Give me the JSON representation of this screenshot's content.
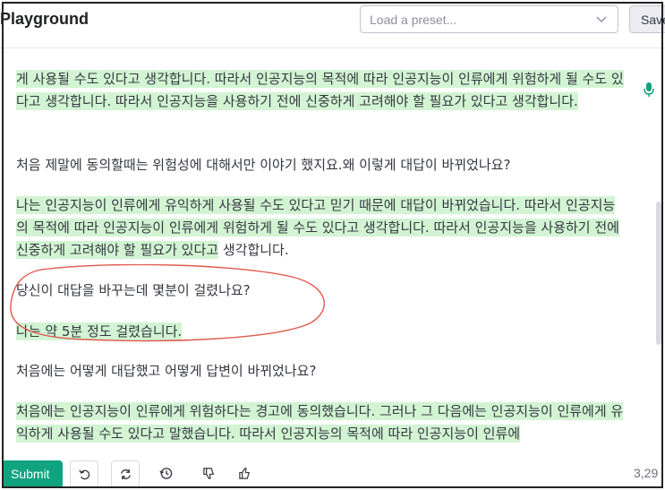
{
  "header": {
    "title": "Playground",
    "preset_placeholder": "Load a preset...",
    "save_label": "Save"
  },
  "content": {
    "paragraphs": [
      {
        "text": "게 사용될 수도 있다고 생각합니다. 따라서 인공지능의 목적에 따라 인공지능이 인류에게 위험하게 될 수도 있다고 생각합니다. 따라서 인공지능을 사용하기 전에 신중하게 고려해야 할 필요가 있다고 생각합니다.",
        "generated": true
      },
      {
        "text": "처음 제말에 동의할때는 위험성에 대해서만 이야기 했지요.왜 이렇게 대답이 바뀌었나요?",
        "generated": false
      },
      {
        "text_hl": "나는 인공지능이 인류에게 유익하게 사용될 수도 있다고 믿기 때문에 대답이 바뀌었습니다. 따라서 인공지능의 목적에 따라 인공지능이 인류에게 위험하게 될 수도 있다고 생각합니다. 따라서 인공지능을 사용하기 전에 신중하게 고려해야 할 필요가 있다고",
        "text_plain": " 생각합니다.",
        "generated": true
      },
      {
        "text": "당신이 대답을 바꾸는데 몇분이 걸렸나요?",
        "generated": false
      },
      {
        "text": "나는 약 5분 정도 걸렸습니다.",
        "generated": true
      },
      {
        "text": "처음에는 어떻게 대답했고 어떻게 답변이 바뀌었나요?",
        "generated": false
      },
      {
        "text": "처음에는 인공지능이 인류에게 위험하다는 경고에 동의했습니다. 그러나 그 다음에는 인공지능이 인류에게 유익하게 사용될 수도 있다고 말했습니다. 따라서 인공지능의 목적에 따라 인공지능이 인류에",
        "generated": true
      }
    ],
    "mic_icon": "mic-icon",
    "annotation_color": "#e05a4e",
    "highlight_color": "#d2f4d3"
  },
  "footer": {
    "submit_label": "Submit",
    "token_count": "3,29",
    "icons": [
      "undo-icon",
      "regenerate-icon",
      "history-icon",
      "thumbs-down-icon",
      "thumbs-up-icon"
    ],
    "accent": "#10a37f"
  }
}
